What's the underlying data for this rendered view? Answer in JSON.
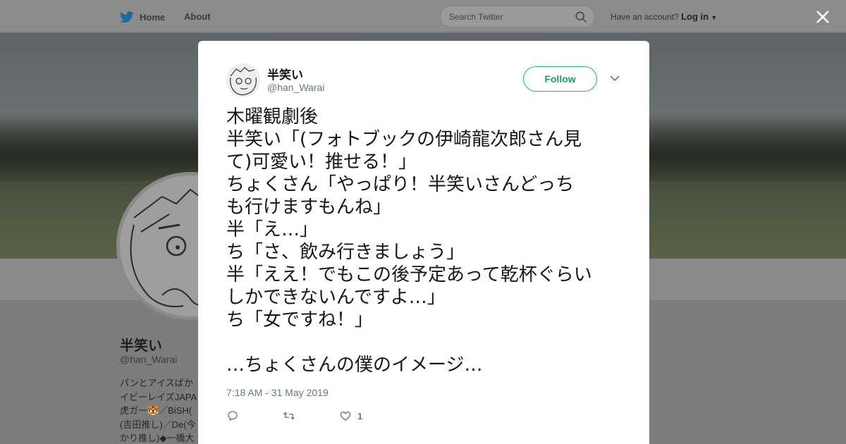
{
  "topbar": {
    "home_label": "Home",
    "about_label": "About",
    "search_placeholder": "Search Twitter",
    "account_prompt": "Have an account?",
    "login_label": "Log in"
  },
  "profile": {
    "name": "半笑い",
    "handle": "@han_Warai",
    "bio": "パンとアイスばか\nイビーレイズJAPA\n虎ガー🐯／BiSH(\n(吉田推し)／De(今\nかり推し)◆一橋大"
  },
  "tweet": {
    "author_name": "半笑い",
    "author_handle": "@han_Warai",
    "follow_label": "Follow",
    "lines": [
      "木曜観劇後",
      "半笑い「(フォトブックの伊崎龍次郎さん見",
      "て)可愛い！推せる！」",
      "ちょくさん「やっぱり！半笑いさんどっち",
      "も行けますもんね」",
      "半「え…」",
      "ち「さ、飲み行きましょう」",
      "半「ええ！でもこの後予定あって乾杯ぐらい",
      "しかできないんですよ…」",
      "ち「女ですね！」",
      "",
      "…ちょくさんの僕のイメージ…"
    ],
    "timestamp": "7:18 AM - 31 May 2019",
    "like_count": "1"
  },
  "colors": {
    "follow_green": "#17bf63",
    "twitter_blue": "#1da1f2",
    "secondary_text": "#657786"
  }
}
